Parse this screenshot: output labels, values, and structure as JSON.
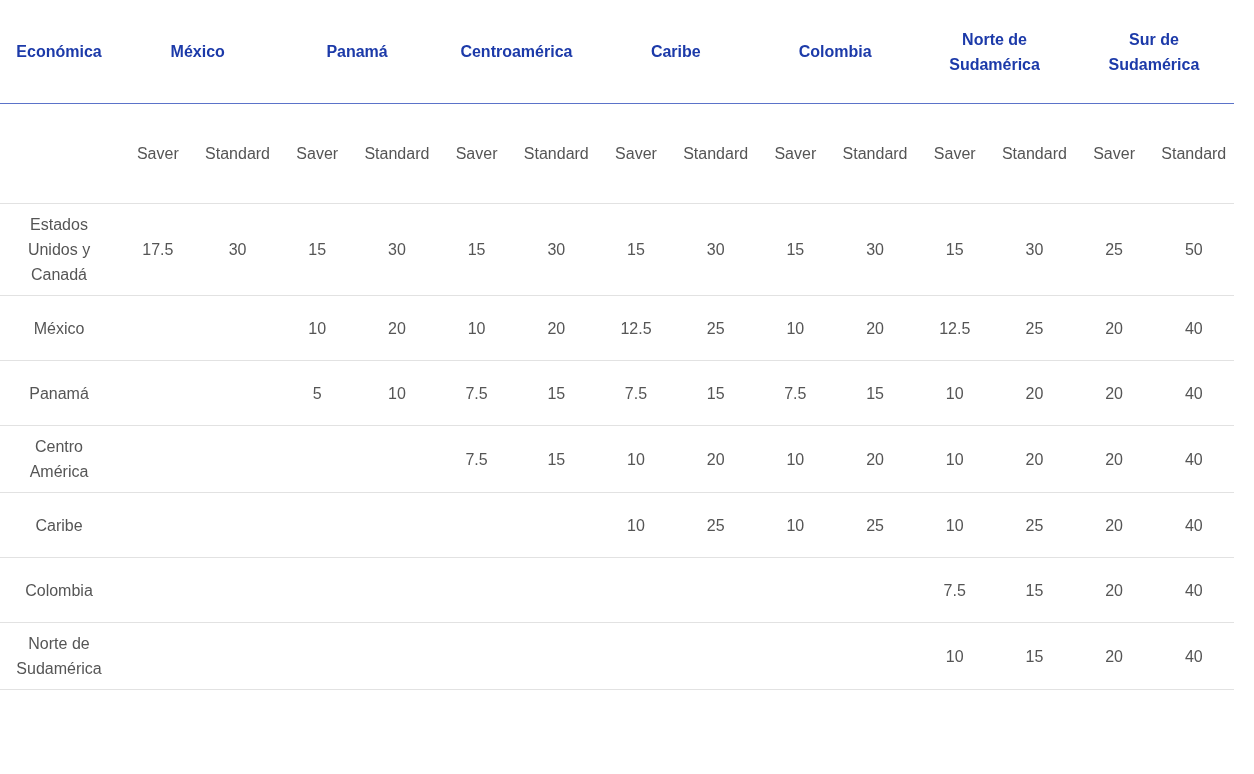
{
  "table": {
    "corner": "Económica",
    "regions": [
      "México",
      "Panamá",
      "Centroamérica",
      "Caribe",
      "Colombia",
      "Norte de Sudamérica",
      "Sur de Sudamérica"
    ],
    "subheaders": [
      "Saver",
      "Standard",
      "Saver",
      "Standard",
      "Saver",
      "Standard",
      "Saver",
      "Standard",
      "Saver",
      "Standard",
      "Saver",
      "Standard",
      "Saver",
      "Standard"
    ],
    "rows": [
      {
        "label": "Estados Unidos y Canadá",
        "values": [
          "17.5",
          "30",
          "15",
          "30",
          "15",
          "30",
          "15",
          "30",
          "15",
          "30",
          "15",
          "30",
          "25",
          "50"
        ]
      },
      {
        "label": "México",
        "values": [
          "10",
          "20",
          "10",
          "20",
          "12.5",
          "25",
          "10",
          "20",
          "12.5",
          "25",
          "20",
          "40"
        ]
      },
      {
        "label": "Panamá",
        "values": [
          "5",
          "10",
          "7.5",
          "15",
          "7.5",
          "15",
          "7.5",
          "15",
          "10",
          "20",
          "20",
          "40"
        ]
      },
      {
        "label": "Centro América",
        "values": [
          "7.5",
          "15",
          "10",
          "20",
          "10",
          "20",
          "10",
          "20",
          "20",
          "40"
        ]
      },
      {
        "label": "Caribe",
        "values": [
          "10",
          "25",
          "10",
          "25",
          "10",
          "25",
          "20",
          "40"
        ]
      },
      {
        "label": "Colombia",
        "values": [
          "7.5",
          "15",
          "20",
          "40"
        ]
      },
      {
        "label": "Norte de Sudamérica",
        "values": [
          "10",
          "15",
          "20",
          "40"
        ]
      }
    ]
  }
}
